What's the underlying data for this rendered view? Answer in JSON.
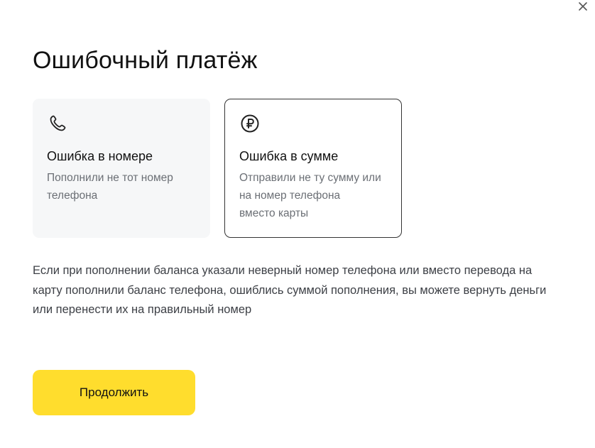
{
  "modal": {
    "title": "Ошибочный платёж",
    "close_icon": "close-icon",
    "cards": [
      {
        "icon": "phone-icon",
        "title": "Ошибка в номере",
        "description": "Пополнили не тот номер\nтелефона",
        "selected": false
      },
      {
        "icon": "ruble-icon",
        "title": "Ошибка в сумме",
        "description": "Отправили не ту сумму или\nна номер телефона\nвместо карты",
        "selected": true
      }
    ],
    "description": "Если при пополнении баланса указали неверный номер телефона или вместо перевода на карту пополнили баланс телефона, ошиблись суммой пополнения, вы можете вернуть деньги или перенести их на правильный номер",
    "continue_label": "Продолжить"
  },
  "colors": {
    "accent": "#ffdd2d",
    "card_inactive_bg": "#f6f7f8",
    "card_active_border": "#333333",
    "secondary_text": "#6b6f75"
  }
}
